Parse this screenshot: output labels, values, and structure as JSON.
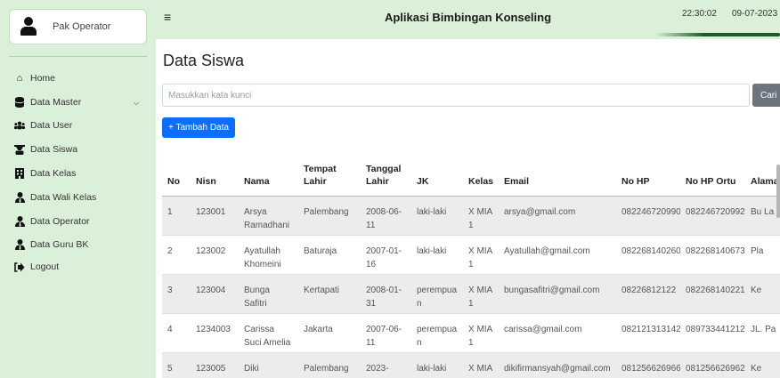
{
  "sidebar": {
    "user_name": "Pak Operator",
    "items": [
      {
        "label": "Home",
        "icon": "home-icon"
      },
      {
        "label": "Data Master",
        "icon": "database-icon"
      },
      {
        "label": "Data User",
        "icon": "users-icon"
      },
      {
        "label": "Data Siswa",
        "icon": "student-icon"
      },
      {
        "label": "Data Kelas",
        "icon": "building-icon"
      },
      {
        "label": "Data Wali Kelas",
        "icon": "user-tie-icon"
      },
      {
        "label": "Data Operator",
        "icon": "user-tie-icon"
      },
      {
        "label": "Data Guru BK",
        "icon": "user-tie-icon"
      },
      {
        "label": "Logout",
        "icon": "sign-out-icon"
      }
    ]
  },
  "topbar": {
    "title": "Aplikasi Bimbingan Konseling",
    "time": "22:30:02",
    "date": "09-07-2023"
  },
  "main": {
    "title": "Data Siswa",
    "search_placeholder": "Masukkan kata kunci",
    "search_button": "Cari",
    "add_button": "+ Tambah Data"
  },
  "table": {
    "headers": [
      "No",
      "Nisn",
      "Nama",
      "Tempat Lahir",
      "Tanggal Lahir",
      "JK",
      "Kelas",
      "Email",
      "No HP",
      "No HP Ortu",
      "Alamat"
    ],
    "rows": [
      [
        "1",
        "123001",
        "Arsya Ramadhani",
        "Palembang",
        "2008-06-11",
        "laki-laki",
        "X MIA 1",
        "arsya@gmail.com",
        "082246720990",
        "082246720992",
        "Bu La"
      ],
      [
        "2",
        "123002",
        "Ayatullah Khomeini",
        "Baturaja",
        "2007-01-16",
        "laki-laki",
        "X MIA 1",
        "Ayatullah@gmail.com",
        "082268140260",
        "082268140673",
        "Pla"
      ],
      [
        "3",
        "123004",
        "Bunga Safitri",
        "Kertapati",
        "2008-01-31",
        "perempuan",
        "X MIA 1",
        "bungasafitri@gmail.com",
        "08226812122",
        "082268140221",
        "Ke"
      ],
      [
        "4",
        "1234003",
        "Carissa Suci Amelia",
        "Jakarta",
        "2007-06-11",
        "perempuan",
        "X MIA 1",
        "carissa@gmail.com",
        "082121313142",
        "089733441212",
        "JL. Pa"
      ],
      [
        "5",
        "123005",
        "Diki",
        "Palembang",
        "2023-",
        "laki-laki",
        "X MIA",
        "dikifirmansyah@gmail.com",
        "081256626966",
        "081256626962",
        "Ke"
      ]
    ]
  }
}
